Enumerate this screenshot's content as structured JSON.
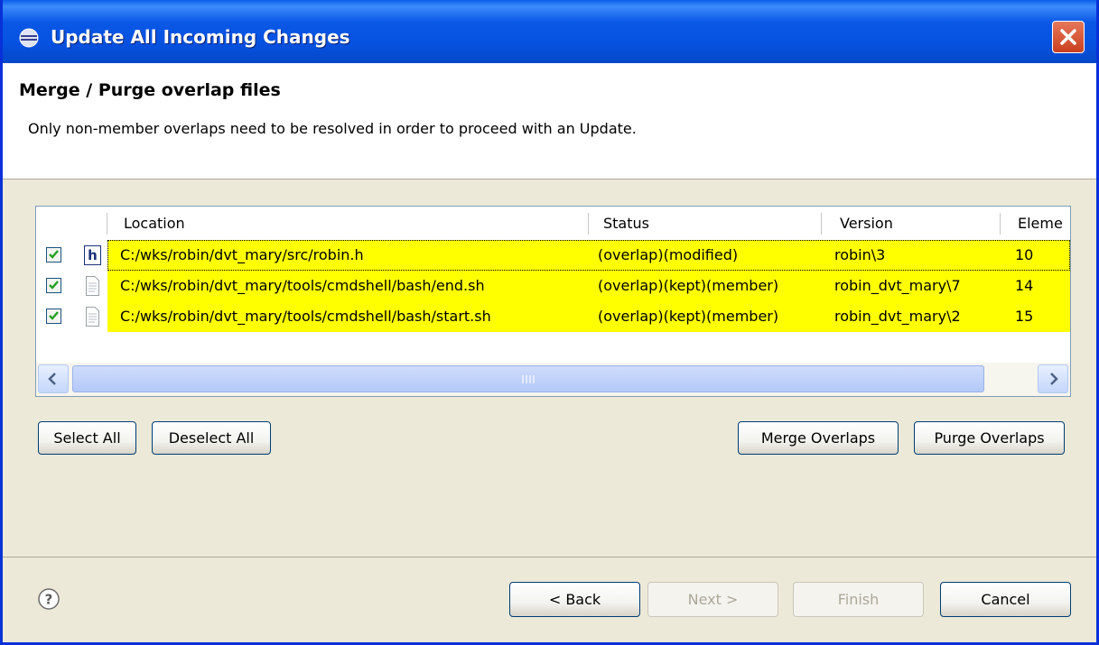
{
  "window": {
    "title": "Update All Incoming Changes",
    "close_icon": "close-icon",
    "title_icon": "eclipse-icon"
  },
  "header": {
    "page_title": "Merge / Purge overlap files",
    "description": "Only non-member overlaps need to be resolved in order to proceed with an Update."
  },
  "table": {
    "columns": [
      "Location",
      "Status",
      "Version",
      "Eleme"
    ],
    "rows": [
      {
        "checked": true,
        "icon": "h-file-icon",
        "location": "C:/wks/robin/dvt_mary/src/robin.h",
        "status": "(overlap)(modified)",
        "version": "robin\\3",
        "element": "10"
      },
      {
        "checked": true,
        "icon": "text-file-icon",
        "location": "C:/wks/robin/dvt_mary/tools/cmdshell/bash/end.sh",
        "status": "(overlap)(kept)(member)",
        "version": "robin_dvt_mary\\7",
        "element": "14"
      },
      {
        "checked": true,
        "icon": "text-file-icon",
        "location": "C:/wks/robin/dvt_mary/tools/cmdshell/bash/start.sh",
        "status": "(overlap)(kept)(member)",
        "version": "robin_dvt_mary\\2",
        "element": "15"
      }
    ],
    "highlight_color": "#ffff00"
  },
  "actions": {
    "select_all": "Select All",
    "deselect_all": "Deselect All",
    "merge_overlaps": "Merge Overlaps",
    "purge_overlaps": "Purge Overlaps"
  },
  "footer": {
    "help_icon": "help-icon",
    "back": "< Back",
    "next": "Next >",
    "finish": "Finish",
    "cancel": "Cancel"
  }
}
